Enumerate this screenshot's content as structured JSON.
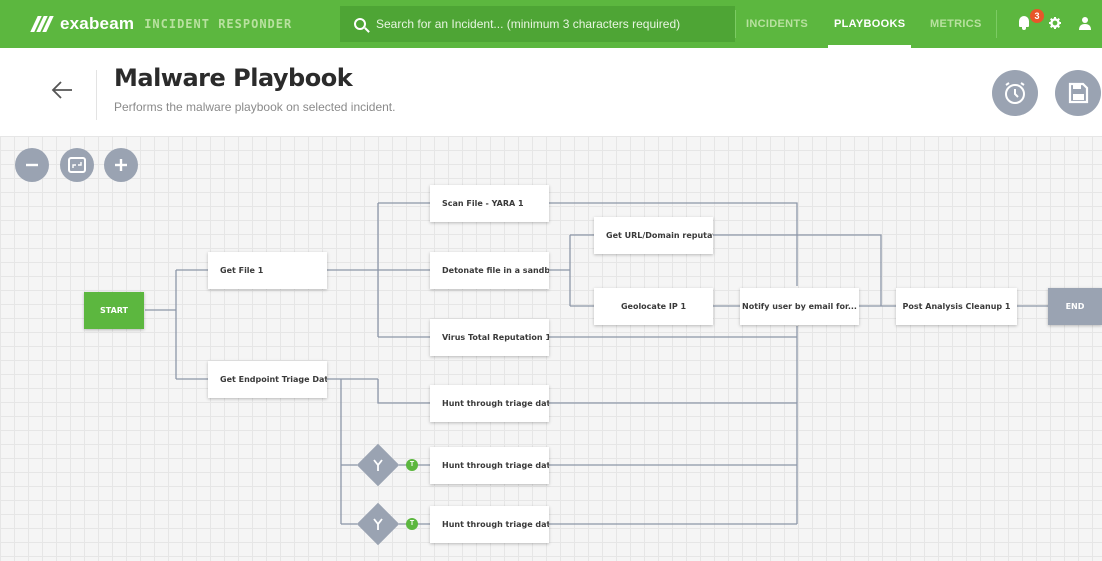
{
  "brand": {
    "name": "exabeam",
    "product": "INCIDENT RESPONDER"
  },
  "search": {
    "placeholder": "Search for an Incident... (minimum 3 characters required)"
  },
  "nav": {
    "items": [
      {
        "label": "INCIDENTS",
        "active": false
      },
      {
        "label": "PLAYBOOKS",
        "active": true
      },
      {
        "label": "METRICS",
        "active": false
      }
    ],
    "notification_count": "3"
  },
  "page": {
    "title": "Malware Playbook",
    "subtitle": "Performs the malware playbook on selected incident."
  },
  "colors": {
    "brand_green": "#5cb73f",
    "node_gray": "#9aa3b2",
    "badge_orange": "#e8562a"
  },
  "flow": {
    "start_label": "START",
    "end_label": "END",
    "nodes": {
      "get_file": "Get File 1",
      "get_endpoint": "Get Endpoint Triage Dat...",
      "scan_file": "Scan File - YARA 1",
      "detonate": "Detonate file in a sandb...",
      "virus_total": "Virus Total Reputation 1",
      "get_url": "Get URL/Domain reputat...",
      "geolocate": "Geolocate IP 1",
      "notify": "Notify user by email for...",
      "post_analysis": "Post Analysis Cleanup 1",
      "hunt_1": "Hunt through triage data...",
      "hunt_2": "Hunt through triage data ...",
      "hunt_3": "Hunt through triage data..."
    },
    "gate_label": "T"
  }
}
